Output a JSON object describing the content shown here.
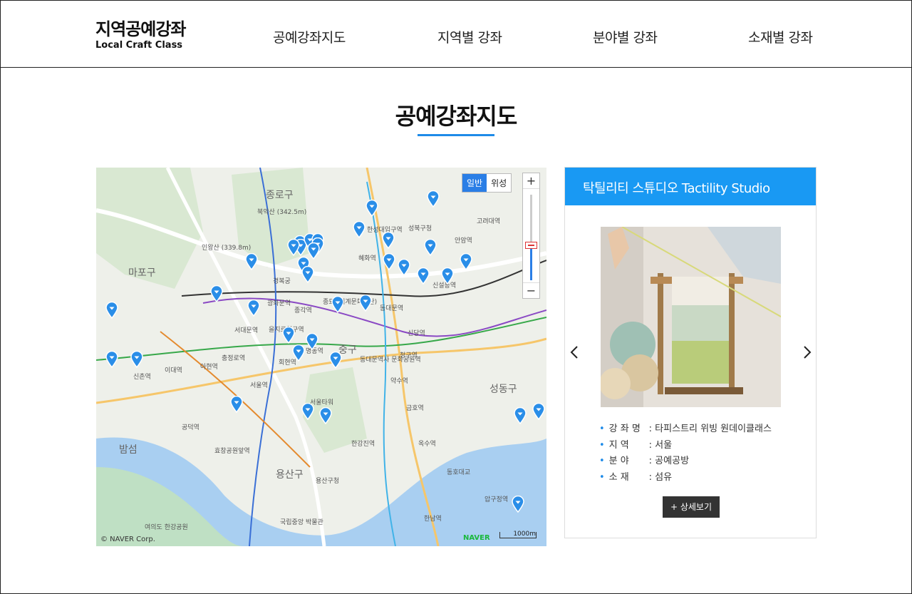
{
  "header": {
    "logo_ko": "지역공예강좌",
    "logo_en": "Local Craft Class",
    "nav": [
      "공예강좌지도",
      "지역별 강좌",
      "분야별 강좌",
      "소재별 강좌"
    ]
  },
  "page_title": "공예강좌지도",
  "map": {
    "map_type": [
      "일반",
      "위성"
    ],
    "zoom_in": "+",
    "zoom_out": "−",
    "copyright": "© NAVER Corp.",
    "brand": "NAVER",
    "scale": "1000m",
    "labels": [
      "종로구",
      "중구",
      "성동구",
      "용산구",
      "마포구",
      "북악산 (342.5m)",
      "인왕산 (339.8m)",
      "경복궁",
      "동대문역",
      "신당역",
      "서울역",
      "청구역",
      "약수역",
      "금호역",
      "옥수역",
      "한남역",
      "동호대교",
      "압구정역",
      "한강진역",
      "서울타워",
      "효창공원앞역",
      "공덕역",
      "신촌역",
      "이대역",
      "아현역",
      "충정로역",
      "서대문역",
      "광화문역",
      "종각역",
      "을지로입구역",
      "회현역",
      "명동역",
      "혜화역",
      "한성대입구역",
      "성북구청",
      "안암역",
      "신설동역",
      "고려대역",
      "용산구청",
      "국립중앙 박물관",
      "여의도 한강공원",
      "밤섬",
      "종묘 (세계문화유산)",
      "동대문역사 문화공원역"
    ],
    "marker_color": "#2a8ee8"
  },
  "panel": {
    "title": "탁틸리티 스튜디오 Tactility Studio",
    "header_color": "#1999f3",
    "info": [
      {
        "label": "강 좌 명",
        "value": ": 타피스트리 위빙 원데이클래스"
      },
      {
        "label": "지 역",
        "value": ": 서울"
      },
      {
        "label": "분 야",
        "value": ": 공예공방"
      },
      {
        "label": "소 재",
        "value": ": 섬유"
      }
    ],
    "detail_button": "+ 상세보기",
    "prev_icon": "chevron-left-icon",
    "next_icon": "chevron-right-icon"
  }
}
